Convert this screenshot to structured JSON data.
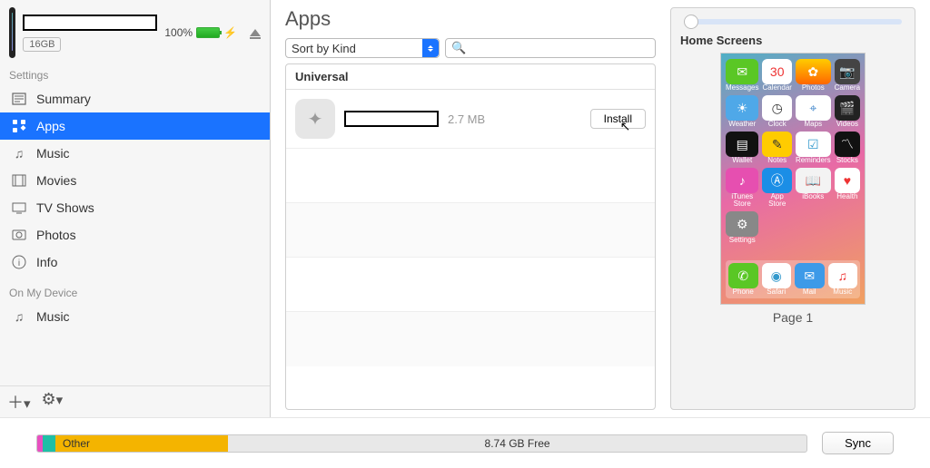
{
  "device": {
    "name_redacted": true,
    "storage_label": "16GB",
    "battery_percent": "100%"
  },
  "sidebar": {
    "section_settings": "Settings",
    "section_onmy": "On My Device",
    "items": [
      {
        "label": "Summary"
      },
      {
        "label": "Apps"
      },
      {
        "label": "Music"
      },
      {
        "label": "Movies"
      },
      {
        "label": "TV Shows"
      },
      {
        "label": "Photos"
      },
      {
        "label": "Info"
      }
    ],
    "onmy_items": [
      {
        "label": "Music"
      }
    ]
  },
  "main": {
    "title": "Apps",
    "sort_label": "Sort by Kind",
    "list_header": "Universal",
    "app_size": "2.7 MB",
    "install_label": "Install"
  },
  "home": {
    "title": "Home Screens",
    "page_label": "Page 1"
  },
  "storage": {
    "other_label": "Other",
    "free_label": "8.74 GB Free"
  },
  "sync_label": "Sync"
}
